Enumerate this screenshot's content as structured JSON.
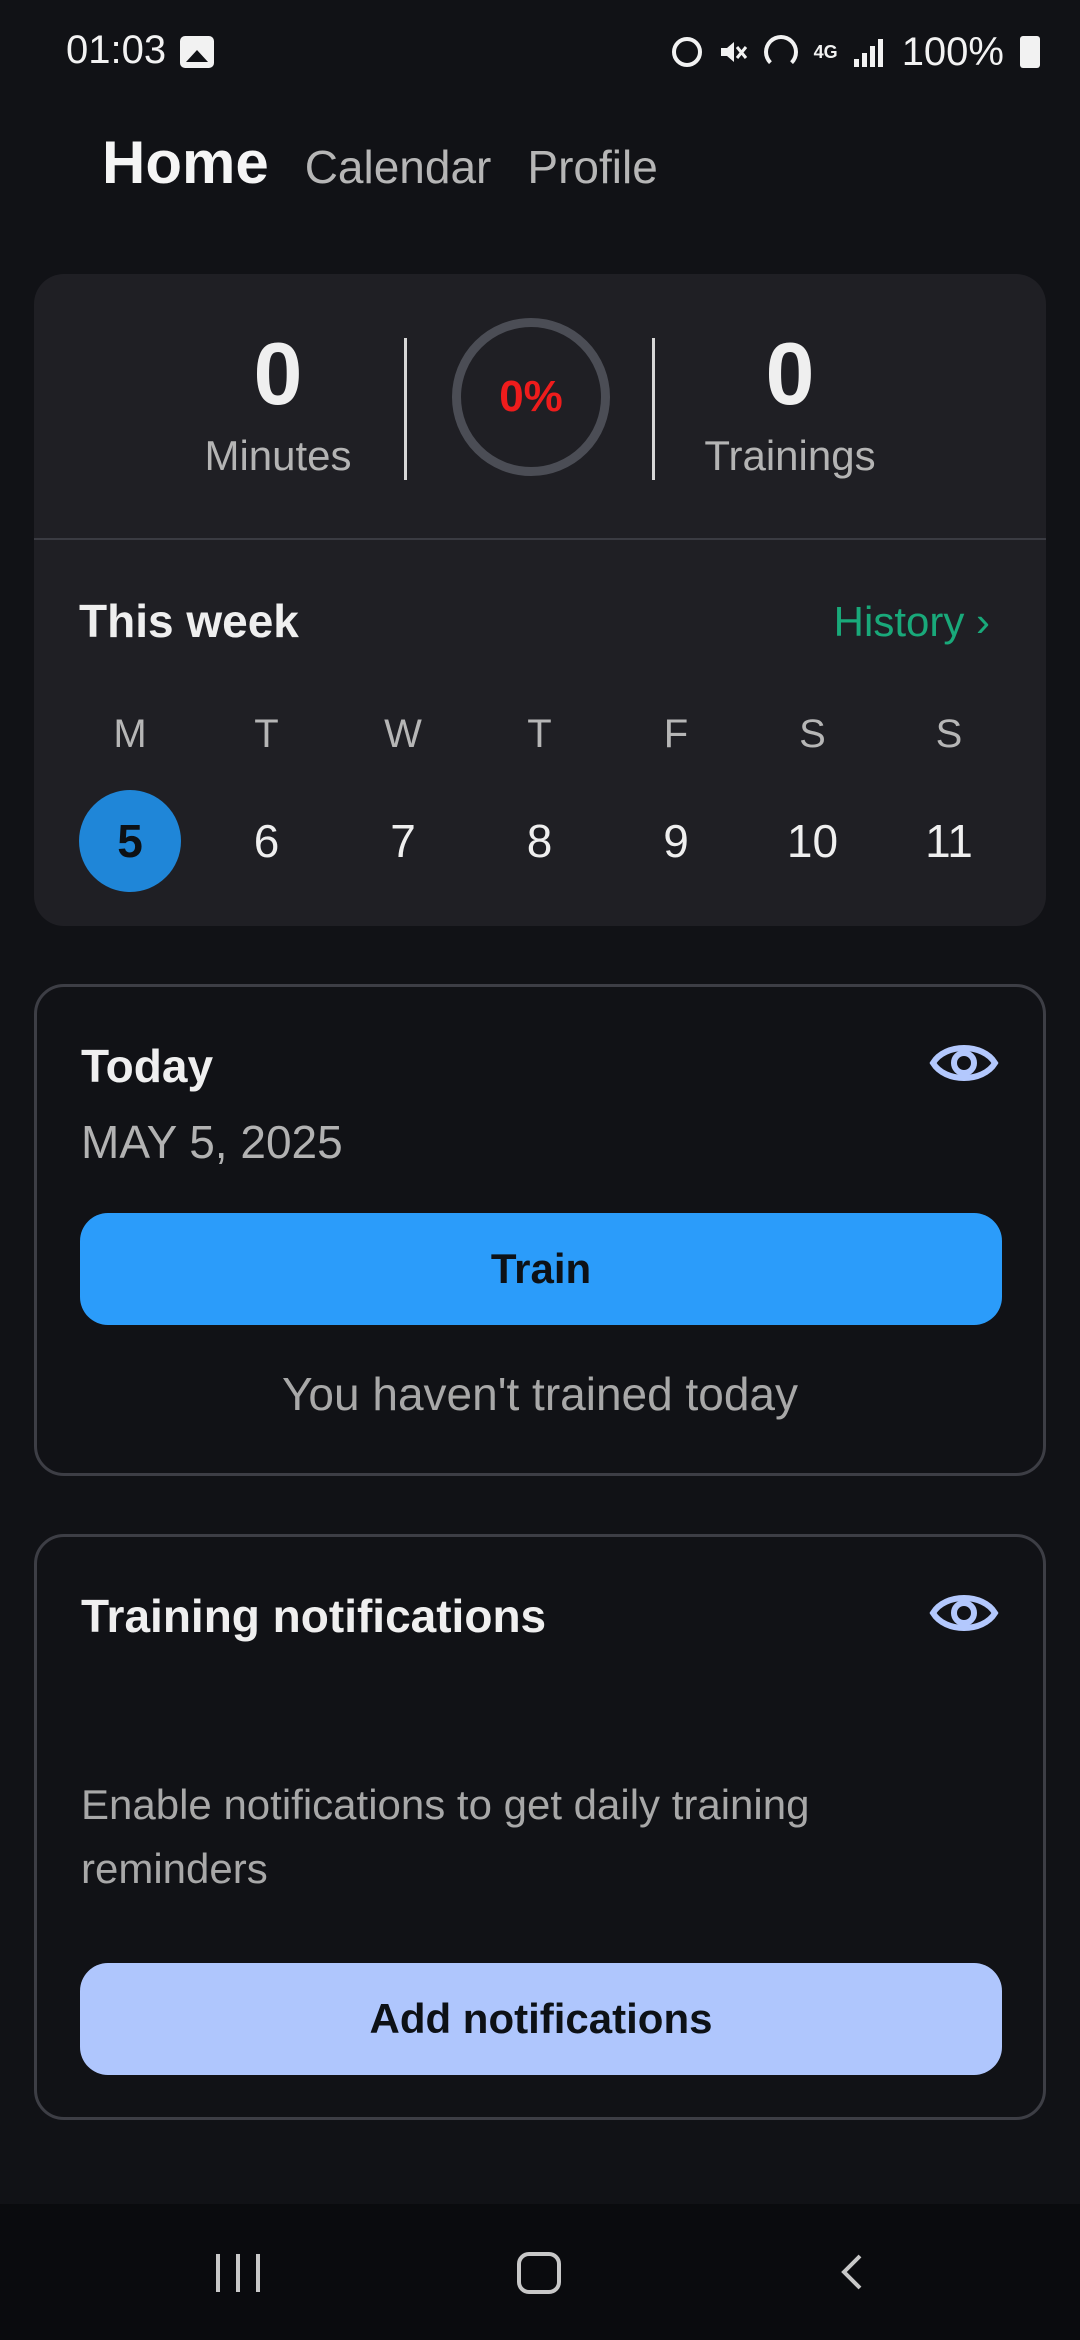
{
  "status_bar": {
    "time": "01:03",
    "battery": "100%",
    "network": "4G",
    "icons": [
      "photo-icon",
      "alarm-icon",
      "mute-icon",
      "hotspot-icon",
      "lte-icon",
      "signal-icon",
      "battery-icon"
    ]
  },
  "tabs": {
    "home": "Home",
    "calendar": "Calendar",
    "profile": "Profile",
    "active": "home"
  },
  "stats": {
    "minutes_value": "0",
    "minutes_label": "Minutes",
    "progress_text": "0%",
    "progress_value": 0,
    "trainings_value": "0",
    "trainings_label": "Trainings"
  },
  "week": {
    "title": "This week",
    "history_link": "History ›",
    "days": [
      {
        "letter": "M",
        "num": "5"
      },
      {
        "letter": "T",
        "num": "6"
      },
      {
        "letter": "W",
        "num": "7"
      },
      {
        "letter": "T",
        "num": "8"
      },
      {
        "letter": "F",
        "num": "9"
      },
      {
        "letter": "S",
        "num": "10"
      },
      {
        "letter": "S",
        "num": "11"
      }
    ],
    "current_day": "5"
  },
  "today": {
    "title": "Today",
    "date": "MAY 5, 2025",
    "train_button": "Train",
    "status": "You haven't trained today"
  },
  "notifications": {
    "title": "Training notifications",
    "description": "Enable notifications to get daily training reminders",
    "button": "Add notifications"
  },
  "colors": {
    "background": "#111216",
    "card": "#1f1f24",
    "accent_blue": "#2b9cfa",
    "current_day": "#1f86d8",
    "history_green": "#19a97a",
    "progress_red": "#ee1c1c",
    "notif_button": "#afc6fd",
    "eye_icon": "#b3c8fd"
  }
}
